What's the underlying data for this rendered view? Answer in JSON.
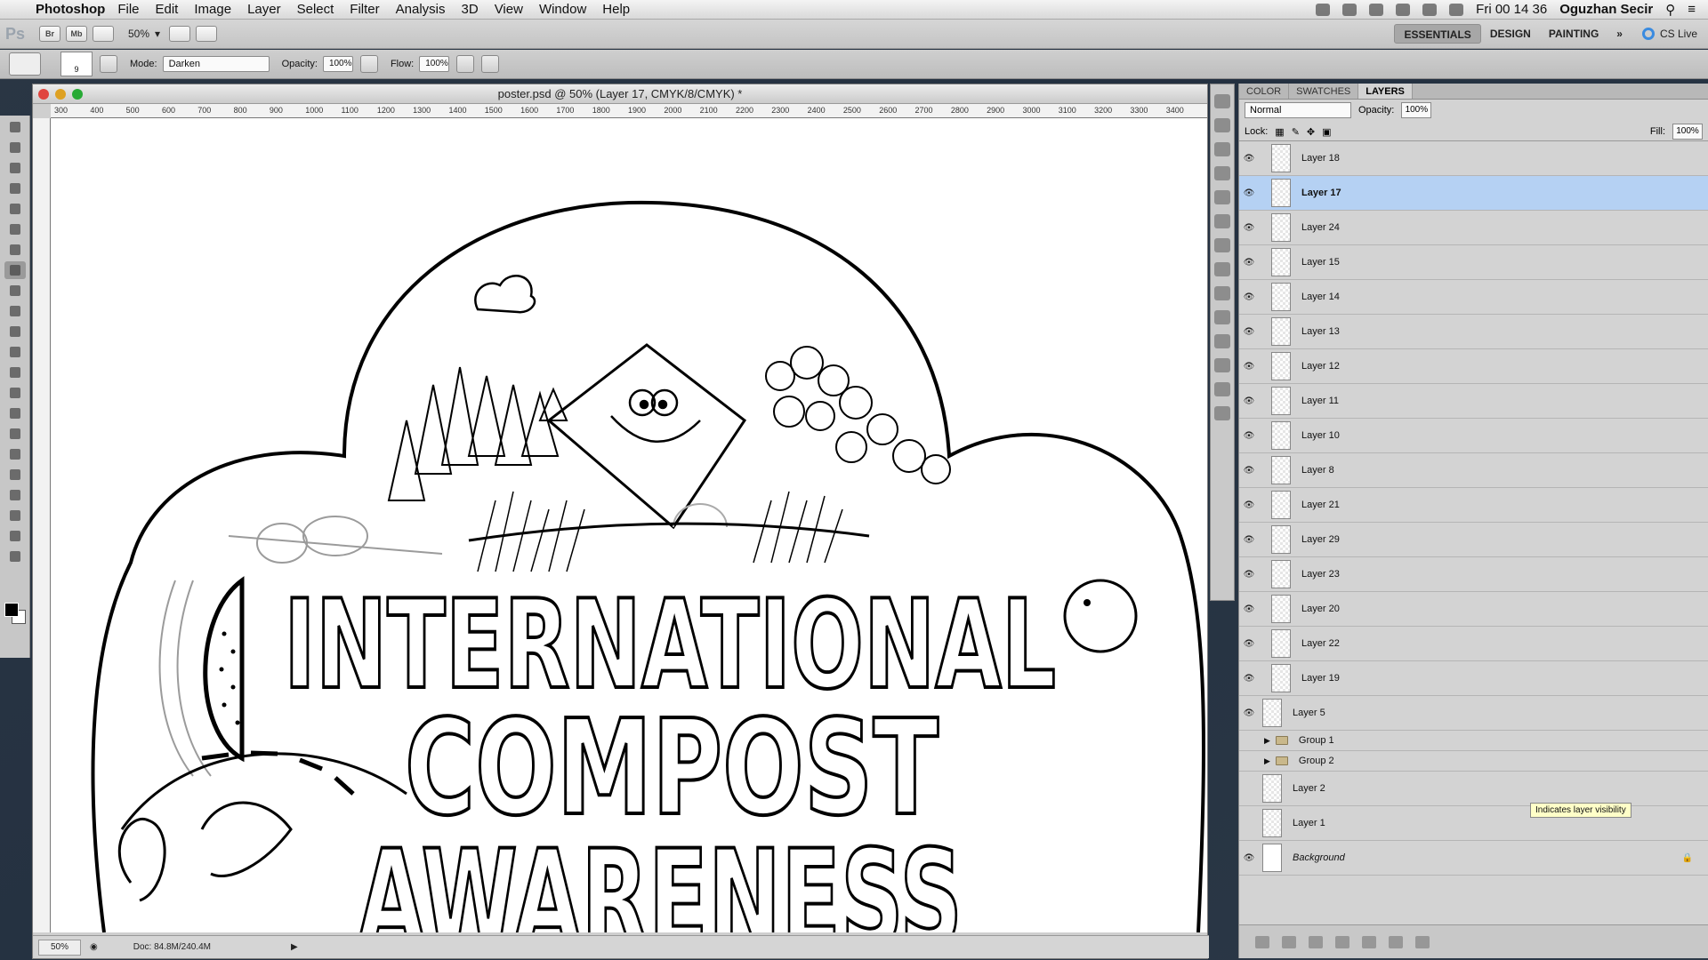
{
  "menubar": {
    "app_name": "Photoshop",
    "items": [
      "File",
      "Edit",
      "Image",
      "Layer",
      "Select",
      "Filter",
      "Analysis",
      "3D",
      "View",
      "Window",
      "Help"
    ],
    "clock": "Fri 00 14 36",
    "user": "Oguzhan Secir"
  },
  "appbar": {
    "logo": "Ps",
    "bridge_label": "Br",
    "minibridge_label": "Mb",
    "zoom": "50%",
    "workspaces": [
      "ESSENTIALS",
      "DESIGN",
      "PAINTING"
    ],
    "more": "»",
    "cs_live": "CS Live"
  },
  "options": {
    "brush_size": "9",
    "mode_label": "Mode:",
    "mode_value": "Darken",
    "opacity_label": "Opacity:",
    "opacity_value": "100%",
    "flow_label": "Flow:",
    "flow_value": "100%"
  },
  "document": {
    "title": "poster.psd @ 50% (Layer 17, CMYK/8/CMYK) *",
    "ruler_ticks": [
      "300",
      "400",
      "500",
      "600",
      "700",
      "800",
      "900",
      "1000",
      "1100",
      "1200",
      "1300",
      "1400",
      "1500",
      "1600",
      "1700",
      "1800",
      "1900",
      "2000",
      "2100",
      "2200",
      "2300",
      "2400",
      "2500",
      "2600",
      "2700",
      "2800",
      "2900",
      "3000",
      "3100",
      "3200",
      "3300",
      "3400"
    ],
    "poster_line1": "INTERNATIONAL",
    "poster_line2": "COMPOST",
    "poster_line3": "AWARENESS",
    "status_zoom": "50%",
    "status_doc": "Doc: 84.8M/240.4M"
  },
  "layers_panel": {
    "tabs": [
      "COLOR",
      "SWATCHES",
      "LAYERS"
    ],
    "active_tab": "LAYERS",
    "blend_mode": "Normal",
    "opacity_label": "Opacity:",
    "opacity_value": "100%",
    "lock_label": "Lock:",
    "fill_label": "Fill:",
    "fill_value": "100%",
    "layers": [
      {
        "name": "Layer 18",
        "visible": true,
        "selected": false,
        "kind": "layer"
      },
      {
        "name": "Layer 17",
        "visible": true,
        "selected": true,
        "kind": "layer"
      },
      {
        "name": "Layer 24",
        "visible": true,
        "selected": false,
        "kind": "layer"
      },
      {
        "name": "Layer 15",
        "visible": true,
        "selected": false,
        "kind": "layer"
      },
      {
        "name": "Layer 14",
        "visible": true,
        "selected": false,
        "kind": "layer"
      },
      {
        "name": "Layer 13",
        "visible": true,
        "selected": false,
        "kind": "layer"
      },
      {
        "name": "Layer 12",
        "visible": true,
        "selected": false,
        "kind": "layer"
      },
      {
        "name": "Layer 11",
        "visible": true,
        "selected": false,
        "kind": "layer"
      },
      {
        "name": "Layer 10",
        "visible": true,
        "selected": false,
        "kind": "layer"
      },
      {
        "name": "Layer 8",
        "visible": true,
        "selected": false,
        "kind": "layer"
      },
      {
        "name": "Layer 21",
        "visible": true,
        "selected": false,
        "kind": "layer"
      },
      {
        "name": "Layer 29",
        "visible": true,
        "selected": false,
        "kind": "layer"
      },
      {
        "name": "Layer 23",
        "visible": true,
        "selected": false,
        "kind": "layer"
      },
      {
        "name": "Layer 20",
        "visible": true,
        "selected": false,
        "kind": "layer"
      },
      {
        "name": "Layer 22",
        "visible": true,
        "selected": false,
        "kind": "layer"
      },
      {
        "name": "Layer 19",
        "visible": true,
        "selected": false,
        "kind": "layer"
      },
      {
        "name": "Layer 5",
        "visible": true,
        "selected": false,
        "kind": "top"
      },
      {
        "name": "Group 1",
        "visible": false,
        "selected": false,
        "kind": "group"
      },
      {
        "name": "Group 2",
        "visible": false,
        "selected": false,
        "kind": "group"
      },
      {
        "name": "Layer 2",
        "visible": false,
        "selected": false,
        "kind": "top"
      },
      {
        "name": "Layer 1",
        "visible": false,
        "selected": false,
        "kind": "top"
      },
      {
        "name": "Background",
        "visible": true,
        "selected": false,
        "kind": "background"
      }
    ],
    "tooltip": "Indicates layer visibility"
  },
  "colors": {
    "selection": "#b5d1f3",
    "accent_blue": "#3a8be0"
  }
}
